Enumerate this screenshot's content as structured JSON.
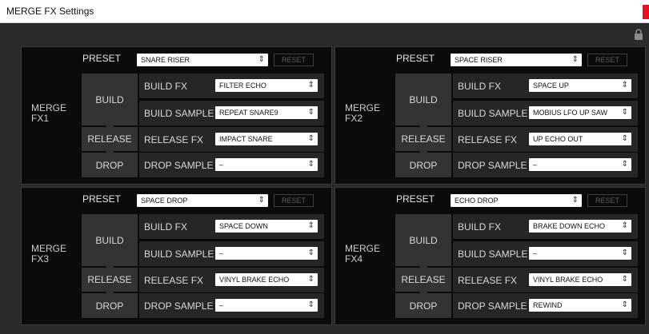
{
  "window": {
    "title": "MERGE FX Settings"
  },
  "labels": {
    "preset": "PRESET",
    "reset": "RESET",
    "build": "BUILD",
    "release": "RELEASE",
    "drop": "DROP",
    "build_fx": "BUILD FX",
    "build_sample": "BUILD SAMPLE",
    "release_fx": "RELEASE FX",
    "drop_sample": "DROP SAMPLE"
  },
  "icons": {
    "lock": "lock-icon",
    "dropdown": "chevron-updown-icon",
    "close": "close-icon"
  },
  "colors": {
    "close": "#e81123",
    "panel": "#0b0b0b",
    "stage": "#333333",
    "row": "#262626"
  },
  "fx": [
    {
      "name": "MERGE\nFX1",
      "preset": "SNARE RISER",
      "build_fx": "FILTER ECHO",
      "build_sample": "REPEAT SNARE9",
      "release_fx": "IMPACT SNARE",
      "drop_sample": "–"
    },
    {
      "name": "MERGE\nFX2",
      "preset": "SPACE RISER",
      "build_fx": "SPACE UP",
      "build_sample": "MOBIUS LFO UP SAW",
      "release_fx": "UP ECHO OUT",
      "drop_sample": "–"
    },
    {
      "name": "MERGE\nFX3",
      "preset": "SPACE DROP",
      "build_fx": "SPACE DOWN",
      "build_sample": "–",
      "release_fx": "VINYL BRAKE ECHO",
      "drop_sample": "–"
    },
    {
      "name": "MERGE\nFX4",
      "preset": "ECHO DROP",
      "build_fx": "BRAKE DOWN ECHO",
      "build_sample": "–",
      "release_fx": "VINYL BRAKE ECHO",
      "drop_sample": "REWIND"
    }
  ]
}
